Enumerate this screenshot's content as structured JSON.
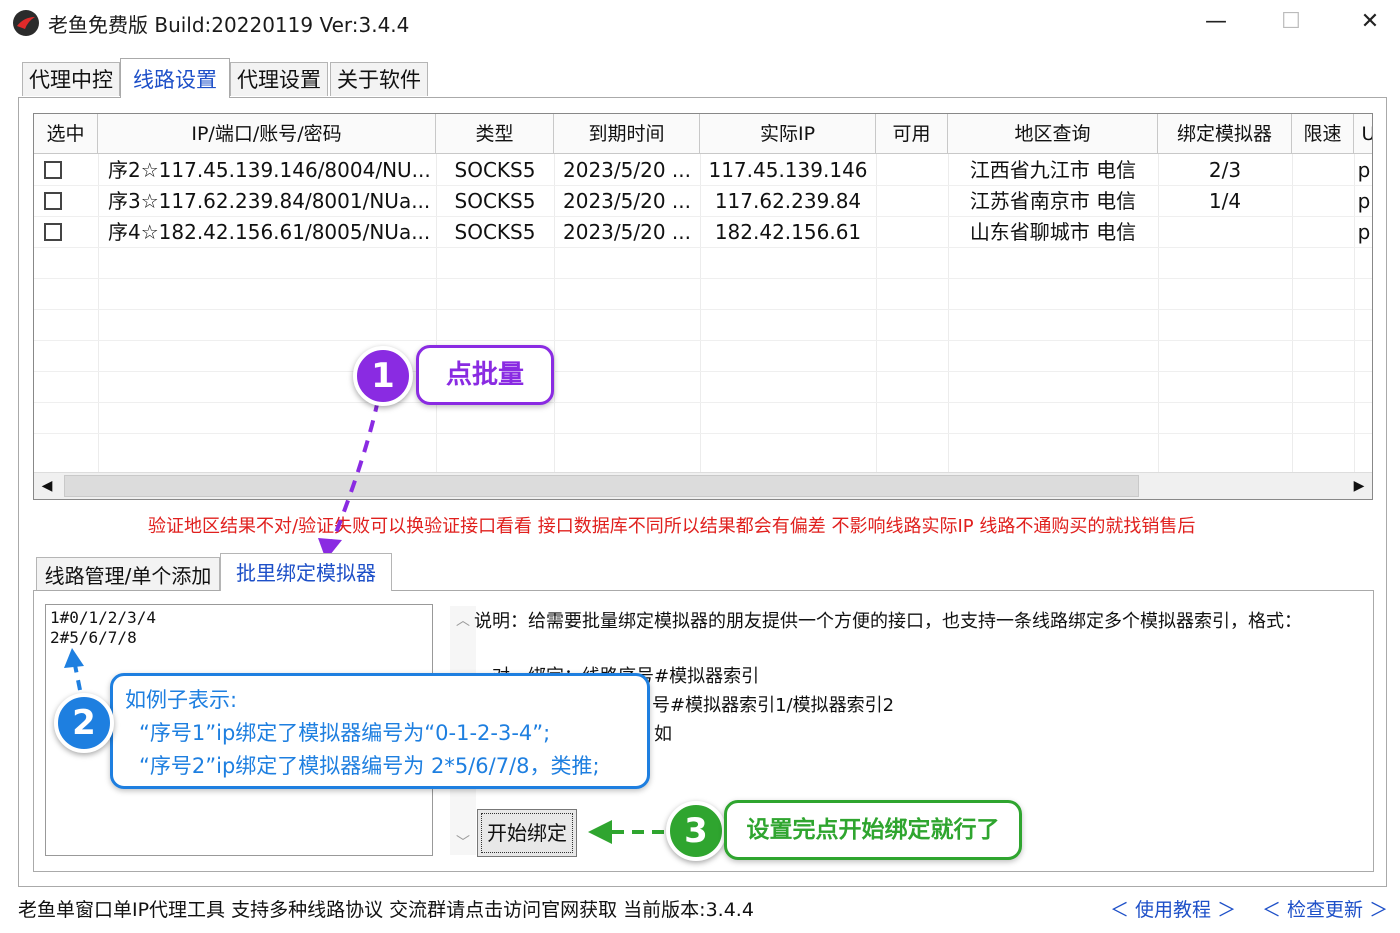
{
  "window": {
    "title": "老鱼免费版 Build:20220119 Ver:3.4.4",
    "minimize": "—",
    "maximize": "☐",
    "close": "✕"
  },
  "main_tabs": [
    {
      "label": "代理中控"
    },
    {
      "label": "线路设置"
    },
    {
      "label": "代理设置"
    },
    {
      "label": "关于软件"
    }
  ],
  "active_main_tab": "线路设置",
  "table": {
    "headers": [
      "选中",
      "IP/端口/账号/密码",
      "类型",
      "到期时间",
      "实际IP",
      "可用",
      "地区查询",
      "绑定模拟器",
      "限速",
      "U"
    ],
    "rows": [
      {
        "ip": "序2☆117.45.139.146/8004/NU...",
        "type": "SOCKS5",
        "expire": "2023/5/20 ...",
        "real_ip": "117.45.139.146",
        "available": "",
        "region": "江西省九江市 电信",
        "bind": "2/3",
        "limit": "",
        "u": "p"
      },
      {
        "ip": "序3☆117.62.239.84/8001/NUa...",
        "type": "SOCKS5",
        "expire": "2023/5/20 ...",
        "real_ip": "117.62.239.84",
        "available": "",
        "region": "江苏省南京市 电信",
        "bind": "1/4",
        "limit": "",
        "u": "p"
      },
      {
        "ip": "序4☆182.42.156.61/8005/NUa...",
        "type": "SOCKS5",
        "expire": "2023/5/20 ...",
        "real_ip": "182.42.156.61",
        "available": "",
        "region": "山东省聊城市 电信",
        "bind": "",
        "limit": "",
        "u": "p"
      }
    ]
  },
  "warning": "验证地区结果不对/验证失败可以换验证接口看看 接口数据库不同所以结果都会有偏差 不影响线路实际IP 线路不通购买的就找销售后",
  "sub_tabs": [
    {
      "label": "线路管理/单个添加"
    },
    {
      "label": "批里绑定模拟器"
    }
  ],
  "bind_text_value": "1#0/1/2/3/4\n2#5/6/7/8",
  "description": {
    "line1": "说明：给需要批量绑定模拟器的朋友提供一个方便的接口，也支持一条线路绑定多个模拟器索引，格式：",
    "line2": "对一绑定：线路序号#模拟器索引",
    "line3": "号#模拟器索引1/模拟器索引2",
    "line4": "如"
  },
  "start_button": "开始绑定",
  "status": {
    "text": "老鱼单窗口单IP代理工具 支持多种线路协议 交流群请点击访问官网获取  当前版本:3.4.4",
    "tutorial_link": "＜ 使用教程 ＞",
    "update_link": "＜ 检查更新 ＞"
  },
  "annotations": {
    "step1": {
      "number": "1",
      "text": "点批量",
      "color": "#8a2be2"
    },
    "step2": {
      "number": "2",
      "title": "如例子表示:",
      "line1": "“序号1”ip绑定了模拟器编号为“0-1-2-3-4”;",
      "line2": "“序号2”ip绑定了模拟器编号为 2*5/6/7/8，类推;",
      "color": "#1e7fe0"
    },
    "step3": {
      "number": "3",
      "text": "设置完点开始绑定就行了",
      "color": "#2fa52f"
    }
  },
  "colors": {
    "accent": "#1e50c8",
    "warning": "#e0201e"
  }
}
